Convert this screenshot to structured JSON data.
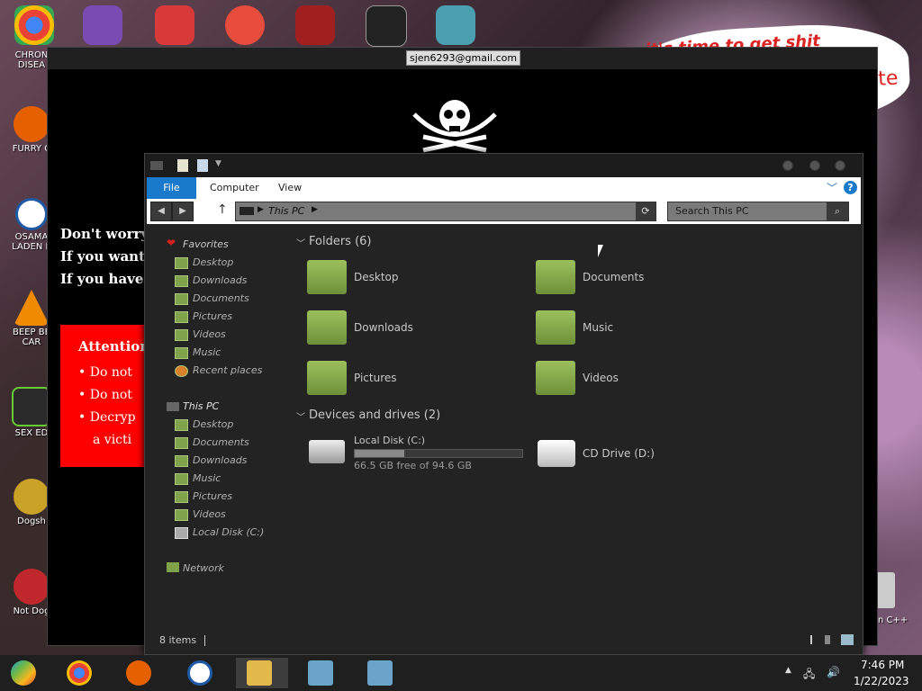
{
  "desktop": {
    "icons": [
      {
        "label": "CHRON\nDISEA"
      },
      {
        "label": "FURRY C"
      },
      {
        "label": "OSAMA\nLADEN E"
      },
      {
        "label": "BEEP BE\nCAR"
      },
      {
        "label": "SEX ED"
      },
      {
        "label": "Dogsh"
      },
      {
        "label": "Not Dog"
      }
    ],
    "right_text_1": "it's time to get shit",
    "right_text_2": "te",
    "right_label": "n C++"
  },
  "ransom": {
    "email": "sjen6293@gmail.com",
    "line1": "Don't worry,",
    "line2": "If you want t",
    "line3": "If you have r",
    "attention_title": "Attention!",
    "bullets": [
      "Do not",
      "Do not",
      "Decryp",
      "a victi"
    ]
  },
  "explorer": {
    "ribbon": {
      "file": "File",
      "computer": "Computer",
      "view": "View",
      "help": "?"
    },
    "address": "This PC",
    "search_placeholder": "Search This PC",
    "nav": {
      "favorites": "Favorites",
      "favorites_items": [
        "Desktop",
        "Downloads",
        "Documents",
        "Pictures",
        "Videos",
        "Music",
        "Recent places"
      ],
      "thispc": "This PC",
      "thispc_items": [
        "Desktop",
        "Documents",
        "Downloads",
        "Music",
        "Pictures",
        "Videos",
        "Local Disk (C:)"
      ],
      "network": "Network"
    },
    "folders_header": "Folders (6)",
    "folders": [
      "Desktop",
      "Documents",
      "Downloads",
      "Music",
      "Pictures",
      "Videos"
    ],
    "drives_header": "Devices and drives (2)",
    "drive_c": {
      "name": "Local Disk (C:)",
      "free": "66.5 GB free of 94.6 GB",
      "used_fraction": 0.297
    },
    "drive_d": {
      "name": "CD Drive (D:)"
    },
    "status": "8 items"
  },
  "taskbar": {
    "time": "7:46 PM",
    "date": "1/22/2023"
  }
}
